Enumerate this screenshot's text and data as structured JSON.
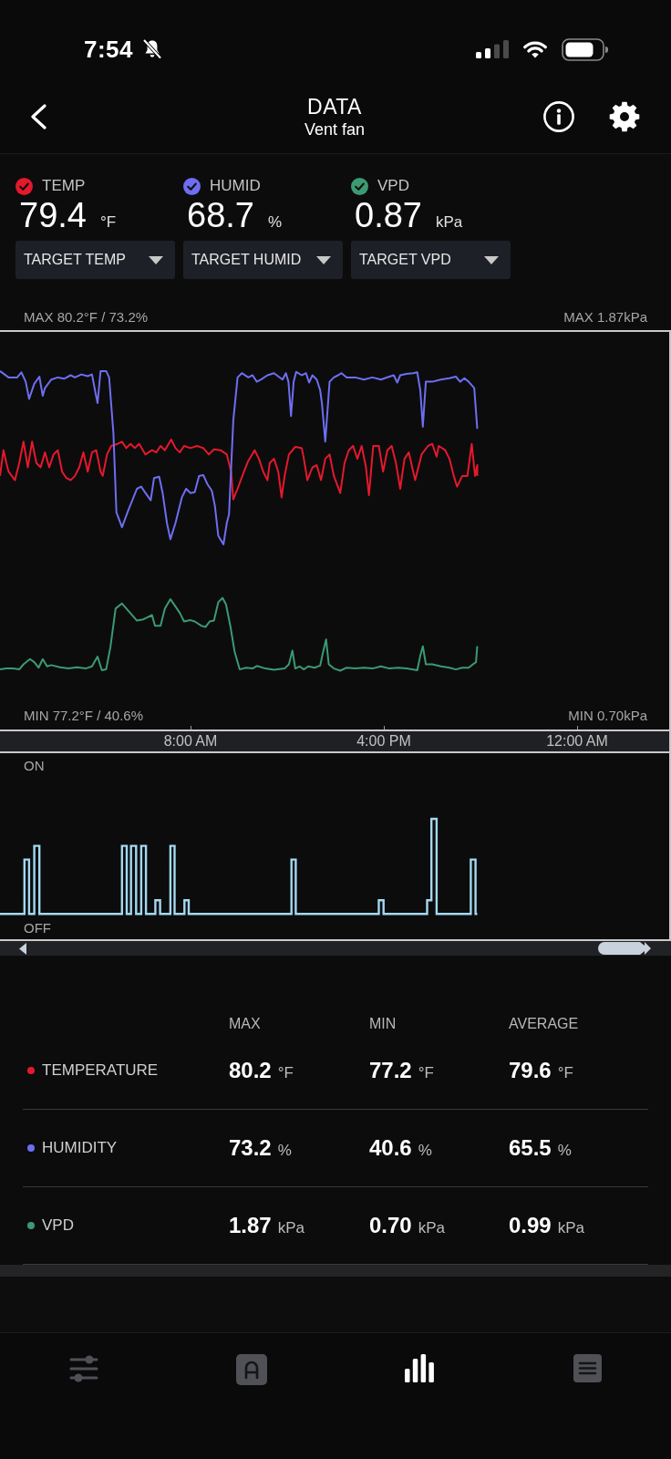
{
  "status_bar": {
    "time": "7:54"
  },
  "header": {
    "title": "DATA",
    "subtitle": "Vent fan"
  },
  "metrics": [
    {
      "label": "TEMP",
      "value": "79.4",
      "unit": "°F",
      "color": "#e5192c",
      "checked": true,
      "dropdown": "TARGET TEMP"
    },
    {
      "label": "HUMID",
      "value": "68.7",
      "unit": "%",
      "color": "#6e6ef2",
      "checked": true,
      "dropdown": "TARGET HUMID"
    },
    {
      "label": "VPD",
      "value": "0.87",
      "unit": "kPa",
      "color": "#3c9a72",
      "checked": true,
      "dropdown": "TARGET VPD"
    }
  ],
  "chart": {
    "max_left": "MAX 80.2°F / 73.2%",
    "max_right": "MAX 1.87kPa",
    "min_left": "MIN 77.2°F / 40.6%",
    "min_right": "MIN 0.70kPa",
    "time_labels": [
      "8:00 AM",
      "4:00 PM",
      "12:00 AM"
    ]
  },
  "fan_chart": {
    "top_label": "ON",
    "bottom_label": "OFF"
  },
  "stats": {
    "columns": [
      "MAX",
      "MIN",
      "AVERAGE"
    ],
    "rows": [
      {
        "name": "TEMPERATURE",
        "color": "#e5192c",
        "cells": [
          {
            "value": "80.2",
            "unit": "°F"
          },
          {
            "value": "77.2",
            "unit": "°F"
          },
          {
            "value": "79.6",
            "unit": "°F"
          }
        ]
      },
      {
        "name": "HUMIDITY",
        "color": "#6e6ef2",
        "cells": [
          {
            "value": "73.2",
            "unit": "%"
          },
          {
            "value": "40.6",
            "unit": "%"
          },
          {
            "value": "65.5",
            "unit": "%"
          }
        ]
      },
      {
        "name": "VPD",
        "color": "#3c9a72",
        "cells": [
          {
            "value": "1.87",
            "unit": "kPa"
          },
          {
            "value": "0.70",
            "unit": "kPa"
          },
          {
            "value": "0.99",
            "unit": "kPa"
          }
        ]
      }
    ]
  },
  "nav": [
    {
      "selected": false
    },
    {
      "selected": false
    },
    {
      "selected": true
    },
    {
      "selected": false
    }
  ]
}
